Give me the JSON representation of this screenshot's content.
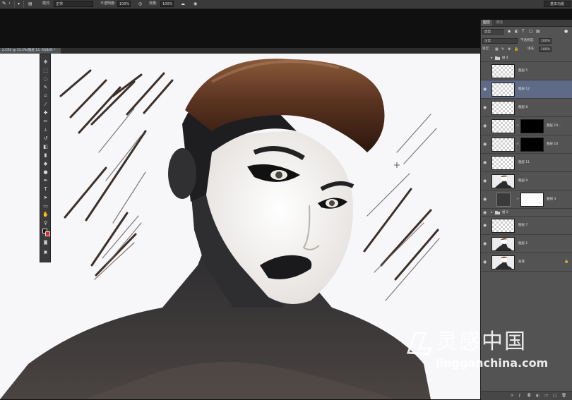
{
  "options_bar": {
    "mode_label": "模式:",
    "mode_value": "正常",
    "opacity_label": "不透明度:",
    "opacity_value": "100%",
    "flow_label": "流量:",
    "flow_value": "100%",
    "workspace": "基本功能"
  },
  "document_tab": {
    "title": "2.CR2 @ 33.3%(图层 12, RGB/8) *"
  },
  "panel": {
    "tabs": [
      "图层",
      "通道"
    ],
    "kind_filter": "类型",
    "blend_mode": "正常",
    "opacity_label": "不透明度:",
    "opacity_value": "100%",
    "lock_label": "锁定:",
    "fill_label": "填充:",
    "fill_value": "100%",
    "layers": [
      {
        "name": "组 4",
        "kind": "group"
      },
      {
        "name": "图层 5",
        "kind": "layer"
      },
      {
        "name": "图层 12",
        "kind": "layer",
        "selected": true
      },
      {
        "name": "图层 8",
        "kind": "layer"
      },
      {
        "name": "图层 10...",
        "kind": "masked"
      },
      {
        "name": "图层 10",
        "kind": "masked"
      },
      {
        "name": "图层 11",
        "kind": "layer"
      },
      {
        "name": "图层 9",
        "kind": "photo"
      },
      {
        "name": "曲线 3",
        "kind": "adjustment"
      },
      {
        "name": "组 2",
        "kind": "group"
      },
      {
        "name": "图层 7",
        "kind": "layer"
      },
      {
        "name": "图层 1",
        "kind": "photo"
      },
      {
        "name": "背景",
        "kind": "background"
      }
    ]
  },
  "watermark": {
    "main": "灵感中国",
    "url": "lingganchina.com"
  },
  "colors": {
    "chrome": "#3a3a3a",
    "panel": "#535353",
    "selected_layer": "#5f6b86",
    "background_color_swatch": "#d42a2a",
    "foreground_color_swatch": "#2a0d0b"
  }
}
